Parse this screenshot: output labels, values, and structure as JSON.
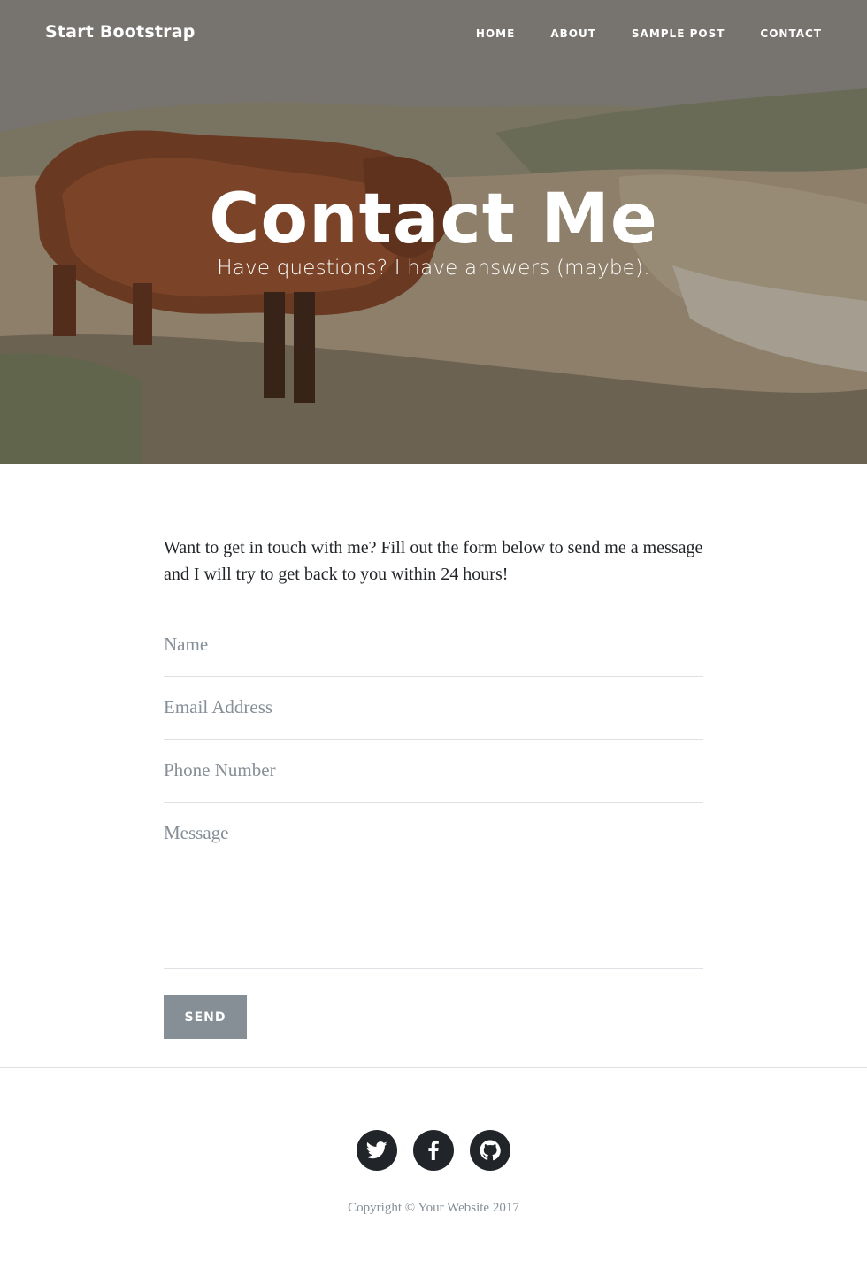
{
  "nav": {
    "brand": "Start Bootstrap",
    "links": [
      "HOME",
      "ABOUT",
      "SAMPLE POST",
      "CONTACT"
    ]
  },
  "masthead": {
    "title": "Contact Me",
    "subtitle": "Have questions? I have answers (maybe)."
  },
  "content": {
    "intro": "Want to get in touch with me? Fill out the form below to send me a message and I will try to get back to you within 24 hours!"
  },
  "form": {
    "name_placeholder": "Name",
    "email_placeholder": "Email Address",
    "phone_placeholder": "Phone Number",
    "message_placeholder": "Message",
    "send_label": "SEND"
  },
  "footer": {
    "social_icons": [
      "twitter-icon",
      "facebook-icon",
      "github-icon"
    ],
    "copyright": "Copyright © Your Website 2017"
  },
  "colors": {
    "primary_text": "#212529",
    "muted": "#868e96",
    "border": "#dee2e6"
  }
}
